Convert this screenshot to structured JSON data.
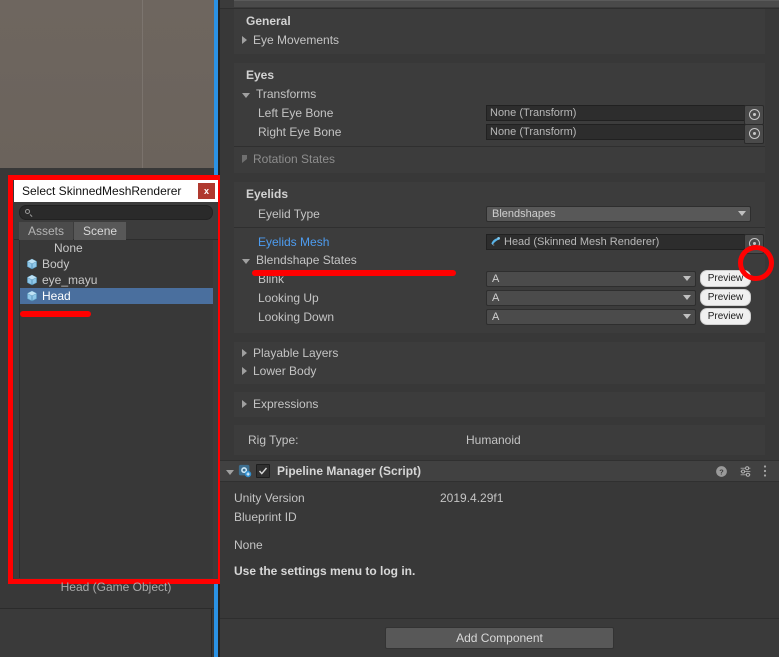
{
  "scene": {
    "status_text": "Head (Game Object)"
  },
  "dialog": {
    "title": "Select SkinnedMeshRenderer",
    "close_label": "x",
    "search_value": "",
    "search_placeholder": "",
    "tabs": [
      {
        "label": "Assets",
        "selected": false
      },
      {
        "label": "Scene",
        "selected": true
      }
    ],
    "items": [
      {
        "label": "None",
        "icon": "",
        "selected": false
      },
      {
        "label": "Body",
        "icon": "prefab-cube-icon",
        "selected": false
      },
      {
        "label": "eye_mayu",
        "icon": "prefab-cube-icon",
        "selected": false
      },
      {
        "label": "Head",
        "icon": "prefab-cube-icon",
        "selected": true
      }
    ]
  },
  "inspector": {
    "general": {
      "header": "General",
      "eye_movements": "Eye Movements"
    },
    "eyes": {
      "header": "Eyes",
      "transforms": "Transforms",
      "left_eye_bone_label": "Left Eye Bone",
      "left_eye_bone_value": "None (Transform)",
      "right_eye_bone_label": "Right Eye Bone",
      "right_eye_bone_value": "None (Transform)",
      "rotation_states": "Rotation States"
    },
    "eyelids": {
      "header": "Eyelids",
      "eyelid_type_label": "Eyelid Type",
      "eyelid_type_value": "Blendshapes",
      "eyelids_mesh_label": "Eyelids Mesh",
      "eyelids_mesh_value": "Head (Skinned Mesh Renderer)",
      "blendshape_states": "Blendshape States",
      "states": [
        {
          "label": "Blink",
          "value": "A",
          "button": "Preview"
        },
        {
          "label": "Looking Up",
          "value": "A",
          "button": "Preview"
        },
        {
          "label": "Looking Down",
          "value": "A",
          "button": "Preview"
        }
      ]
    },
    "body": {
      "playable_layers": "Playable Layers",
      "lower_body": "Lower Body"
    },
    "expressions": {
      "label": "Expressions"
    },
    "rig": {
      "label": "Rig Type:",
      "value": "Humanoid"
    },
    "pipeline_manager": {
      "title": "Pipeline Manager (Script)",
      "enabled": true,
      "unity_version_label": "Unity Version",
      "unity_version_value": "2019.4.29f1",
      "blueprint_id_label": "Blueprint ID",
      "blueprint_id_value": "None",
      "login_hint": "Use the settings menu to log in."
    },
    "add_component": "Add Component"
  },
  "colors": {
    "accent_blue": "#2b92e4",
    "annotation_red": "#ff0000",
    "selection_blue": "#4a6f9e",
    "link_blue": "#4d9cf0",
    "panel_bg": "#383838",
    "card_bg": "#3c3c3c"
  }
}
